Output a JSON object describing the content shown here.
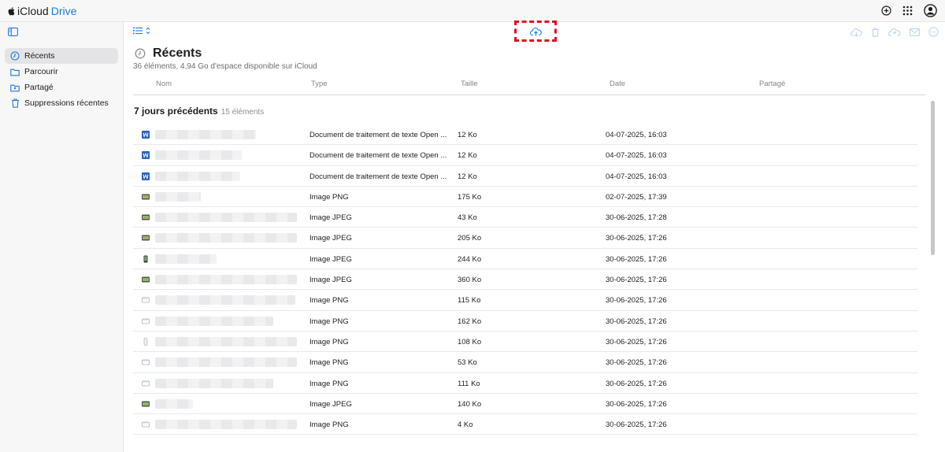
{
  "app": {
    "brand_part1": "iCloud",
    "brand_part2": "Drive",
    "accent": "#1a7ae8"
  },
  "sidebar": {
    "items": [
      {
        "label": "Récents",
        "icon": "clock-icon",
        "active": true
      },
      {
        "label": "Parcourir",
        "icon": "folder-icon",
        "active": false
      },
      {
        "label": "Partagé",
        "icon": "shared-folder-icon",
        "active": false
      },
      {
        "label": "Suppressions récentes",
        "icon": "trash-icon",
        "active": false
      }
    ]
  },
  "toolbar": {
    "upload_icon": "cloud-upload-icon",
    "highlight_color": "#e0101f"
  },
  "page": {
    "title": "Récents",
    "subtitle": "36 éléments, 4,94 Go d'espace disponible sur iCloud"
  },
  "columns": {
    "name": "Nom",
    "type": "Type",
    "size": "Taille",
    "date": "Date",
    "shared": "Partagé"
  },
  "section": {
    "title": "7 jours précédents",
    "count": "15 éléments"
  },
  "files": [
    {
      "icon": "word",
      "type": "Document de traitement de texte Open ...",
      "size": "12 Ko",
      "date": "04-07-2025, 16:03"
    },
    {
      "icon": "word",
      "type": "Document de traitement de texte Open ...",
      "size": "12 Ko",
      "date": "04-07-2025, 16:03"
    },
    {
      "icon": "word",
      "type": "Document de traitement de texte Open ...",
      "size": "12 Ko",
      "date": "04-07-2025, 16:03"
    },
    {
      "icon": "image",
      "type": "Image PNG",
      "size": "175 Ko",
      "date": "02-07-2025, 17:39"
    },
    {
      "icon": "image",
      "type": "Image JPEG",
      "size": "43 Ko",
      "date": "30-06-2025, 17:28"
    },
    {
      "icon": "image",
      "type": "Image JPEG",
      "size": "205 Ko",
      "date": "30-06-2025, 17:26"
    },
    {
      "icon": "phone",
      "type": "Image JPEG",
      "size": "244 Ko",
      "date": "30-06-2025, 17:26"
    },
    {
      "icon": "image",
      "type": "Image JPEG",
      "size": "360 Ko",
      "date": "30-06-2025, 17:26"
    },
    {
      "icon": "window",
      "type": "Image PNG",
      "size": "115 Ko",
      "date": "30-06-2025, 17:26"
    },
    {
      "icon": "window",
      "type": "Image PNG",
      "size": "162 Ko",
      "date": "30-06-2025, 17:26"
    },
    {
      "icon": "bottle",
      "type": "Image PNG",
      "size": "108 Ko",
      "date": "30-06-2025, 17:26"
    },
    {
      "icon": "window",
      "type": "Image PNG",
      "size": "53 Ko",
      "date": "30-06-2025, 17:26"
    },
    {
      "icon": "window",
      "type": "Image PNG",
      "size": "111 Ko",
      "date": "30-06-2025, 17:26"
    },
    {
      "icon": "image",
      "type": "Image JPEG",
      "size": "140 Ko",
      "date": "30-06-2025, 17:26"
    },
    {
      "icon": "window",
      "type": "Image PNG",
      "size": "4 Ko",
      "date": "30-06-2025, 17:26"
    }
  ]
}
